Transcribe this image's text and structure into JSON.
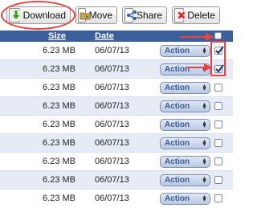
{
  "toolbar": {
    "download_label": "Download",
    "move_label": "Move",
    "share_label": "Share",
    "delete_label": "Delete"
  },
  "header": {
    "size": "Size",
    "date": "Date"
  },
  "rows": [
    {
      "size": "6.23 MB",
      "date": "06/07/13",
      "action": "Action",
      "checked": true
    },
    {
      "size": "6.23 MB",
      "date": "06/07/13",
      "action": "Action",
      "checked": true
    },
    {
      "size": "6.23 MB",
      "date": "06/07/13",
      "action": "Action",
      "checked": false
    },
    {
      "size": "6.23 MB",
      "date": "06/07/13",
      "action": "Action",
      "checked": false
    },
    {
      "size": "6.23 MB",
      "date": "06/07/13",
      "action": "Action",
      "checked": false
    },
    {
      "size": "6.23 MB",
      "date": "06/07/13",
      "action": "Action",
      "checked": false
    },
    {
      "size": "6.23 MB",
      "date": "06/07/13",
      "action": "Action",
      "checked": false
    },
    {
      "size": "6.23 MB",
      "date": "06/07/13",
      "action": "Action",
      "checked": false
    },
    {
      "size": "6.23 MB",
      "date": "06/07/13",
      "action": "Action",
      "checked": false
    }
  ],
  "colors": {
    "header_bg": "#3b5f9a",
    "row_alt_bg": "#e6ebf6",
    "annotation_red": "#e64545"
  },
  "icons": {
    "download": "download-arrow-icon",
    "move": "folder-move-icon",
    "share": "share-icon",
    "delete": "delete-icon"
  }
}
